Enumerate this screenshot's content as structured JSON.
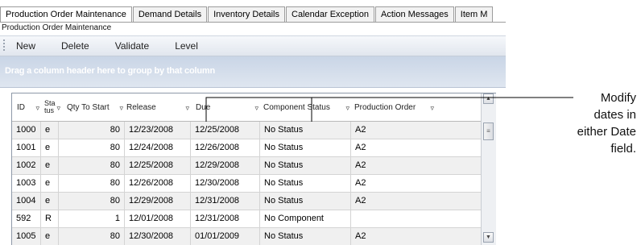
{
  "tabs": [
    {
      "label": "Production Order Maintenance",
      "active": true
    },
    {
      "label": "Demand Details",
      "active": false
    },
    {
      "label": "Inventory Details",
      "active": false
    },
    {
      "label": "Calendar Exception",
      "active": false
    },
    {
      "label": "Action Messages",
      "active": false
    },
    {
      "label": "Item M",
      "active": false
    }
  ],
  "subtitle": "Production Order Maintenance",
  "toolbar": {
    "new": "New",
    "delete": "Delete",
    "validate": "Validate",
    "level": "Level"
  },
  "group_hint": "Drag a column header here to group by that column",
  "columns": {
    "id": "ID",
    "status_top": "Sta",
    "status_bottom": "tus",
    "qty": "Qty To Start",
    "release": "Release",
    "due": "Due",
    "component_status": "Component Status",
    "production_order": "Production Order"
  },
  "rows": [
    [
      "1000",
      "e",
      "80",
      "12/23/2008",
      "12/25/2008",
      "No Status",
      "A2"
    ],
    [
      "1001",
      "e",
      "80",
      "12/24/2008",
      "12/26/2008",
      "No Status",
      "A2"
    ],
    [
      "1002",
      "e",
      "80",
      "12/25/2008",
      "12/29/2008",
      "No Status",
      "A2"
    ],
    [
      "1003",
      "e",
      "80",
      "12/26/2008",
      "12/30/2008",
      "No Status",
      "A2"
    ],
    [
      "1004",
      "e",
      "80",
      "12/29/2008",
      "12/31/2008",
      "No Status",
      "A2"
    ],
    [
      "592",
      "R",
      "1",
      "12/01/2008",
      "12/31/2008",
      "No Component",
      ""
    ],
    [
      "1005",
      "e",
      "80",
      "12/30/2008",
      "01/01/2009",
      "No Status",
      "A2"
    ]
  ],
  "callout": [
    "Modify",
    "dates in",
    "either Date",
    "field."
  ],
  "icons": {
    "filter": "filter-icon",
    "scroll_up": "scroll-up-icon",
    "scroll_down": "scroll-down-icon",
    "grip": "toolbar-grip-icon"
  }
}
